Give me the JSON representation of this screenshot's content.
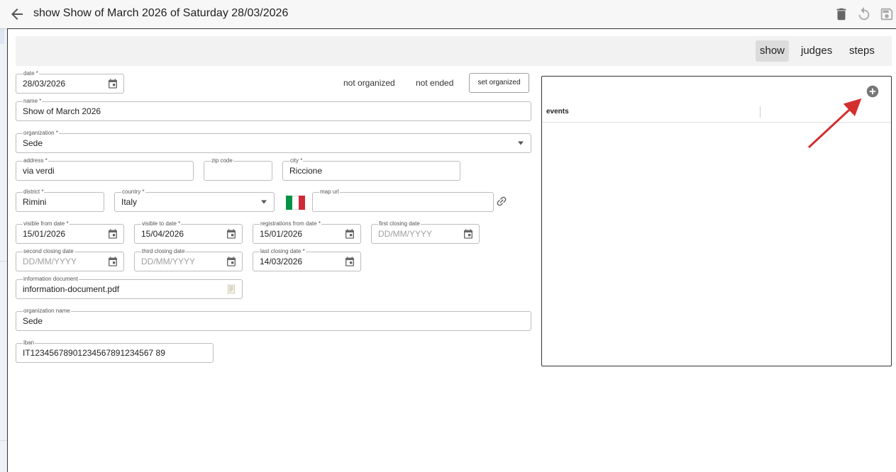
{
  "header": {
    "title": "show Show of March 2026 of Saturday 28/03/2026",
    "back_icon": "arrow-left-icon",
    "delete_icon": "trash-icon",
    "undo_icon": "undo-icon",
    "save_icon": "save-icon"
  },
  "tabs": [
    {
      "label": "show",
      "active": true
    },
    {
      "label": "judges",
      "active": false
    },
    {
      "label": "steps",
      "active": false
    }
  ],
  "status": {
    "organized": "not organized",
    "ended": "not ended",
    "set_organized_label": "set organized"
  },
  "form": {
    "date": {
      "label": "date *",
      "value": "28/03/2026"
    },
    "name": {
      "label": "name *",
      "value": "Show of March 2026"
    },
    "organization": {
      "label": "organization *",
      "value": "Sede"
    },
    "address": {
      "label": "address *",
      "value": "via verdi"
    },
    "zip_code": {
      "label": "zip code",
      "value": ""
    },
    "city": {
      "label": "city *",
      "value": "Riccione"
    },
    "district": {
      "label": "district *",
      "value": "Rimini"
    },
    "country": {
      "label": "country *",
      "value": "Italy"
    },
    "map_url": {
      "label": "map url",
      "value": ""
    },
    "visible_from_date": {
      "label": "visible from date *",
      "value": "15/01/2026"
    },
    "visible_to_date": {
      "label": "visible to date *",
      "value": "15/04/2026"
    },
    "registrations_from_date": {
      "label": "registrations from date *",
      "value": "15/01/2026"
    },
    "first_closing_date": {
      "label": "first closing date",
      "placeholder": "DD/MM/YYYY"
    },
    "second_closing_date": {
      "label": "second closing date",
      "placeholder": "DD/MM/YYYY"
    },
    "third_closing_date": {
      "label": "third closing date",
      "placeholder": "DD/MM/YYYY"
    },
    "last_closing_date": {
      "label": "last closing date *",
      "value": "14/03/2026"
    },
    "information_document": {
      "label": "information document",
      "value": "information-document.pdf"
    },
    "organization_name": {
      "label": "organization name",
      "value": "Sede"
    },
    "iban": {
      "label": "iban",
      "value": "IT12345678901234567891234567 89"
    }
  },
  "events": {
    "column_header": "events",
    "add_icon": "plus-circle-icon"
  },
  "colors": {
    "annotation_arrow": "#d32f2f",
    "flag_green": "#009246",
    "flag_white": "#ffffff",
    "flag_red": "#ce2b37"
  }
}
